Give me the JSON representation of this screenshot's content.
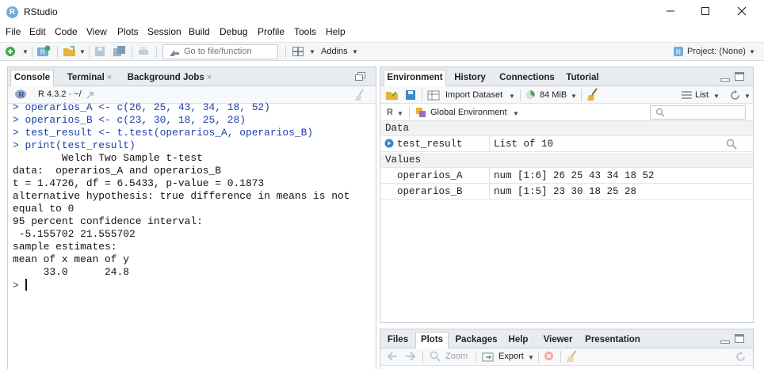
{
  "window": {
    "title": "RStudio"
  },
  "menu": [
    "File",
    "Edit",
    "Code",
    "View",
    "Plots",
    "Session",
    "Build",
    "Debug",
    "Profile",
    "Tools",
    "Help"
  ],
  "toolbar": {
    "goto_placeholder": "Go to file/function",
    "addins_label": "Addins",
    "project_label": "Project: (None)"
  },
  "console": {
    "tabs": [
      {
        "label": "Console",
        "closable": false
      },
      {
        "label": "Terminal",
        "closable": true
      },
      {
        "label": "Background Jobs",
        "closable": true
      }
    ],
    "close_glyph": "×",
    "r_version": "R 4.3.2 · ~/",
    "prompt": ">",
    "lines": [
      {
        "text": "> operarios_A <- c(26, 25, 43, 34, 18, 52)",
        "kind": "cmd"
      },
      {
        "text": "> operarios_B <- c(23, 30, 18, 25, 28)",
        "kind": "cmd"
      },
      {
        "text": "> test_result <- t.test(operarios_A, operarios_B)",
        "kind": "cmd"
      },
      {
        "text": "> print(test_result)",
        "kind": "cmd"
      },
      {
        "text": "",
        "kind": "out"
      },
      {
        "text": "\tWelch Two Sample t-test",
        "kind": "out"
      },
      {
        "text": "",
        "kind": "out"
      },
      {
        "text": "data:  operarios_A and operarios_B",
        "kind": "out"
      },
      {
        "text": "t = 1.4726, df = 6.5433, p-value = 0.1873",
        "kind": "out"
      },
      {
        "text": "alternative hypothesis: true difference in means is not",
        "kind": "out"
      },
      {
        "text": "equal to 0",
        "kind": "out"
      },
      {
        "text": "95 percent confidence interval:",
        "kind": "out"
      },
      {
        "text": " -5.155702 21.555702",
        "kind": "out"
      },
      {
        "text": "sample estimates:",
        "kind": "out"
      },
      {
        "text": "mean of x mean of y ",
        "kind": "out"
      },
      {
        "text": "     33.0      24.8 ",
        "kind": "out"
      },
      {
        "text": "",
        "kind": "out"
      }
    ]
  },
  "environment": {
    "tabs": [
      "Environment",
      "History",
      "Connections",
      "Tutorial"
    ],
    "import_label": "Import Dataset",
    "memory_label": "84 MiB",
    "list_label": "List",
    "language_label": "R",
    "scope_label": "Global Environment",
    "data_header": "Data",
    "data_rows": [
      {
        "name": "test_result",
        "value": "List of  10"
      }
    ],
    "values_header": "Values",
    "value_rows": [
      {
        "name": "operarios_A",
        "value": "num [1:6] 26 25 43 34 18 52"
      },
      {
        "name": "operarios_B",
        "value": "num [1:5] 23 30 18 25 28"
      }
    ]
  },
  "files": {
    "tabs": [
      "Files",
      "Plots",
      "Packages",
      "Help",
      "Viewer",
      "Presentation"
    ],
    "active_tab": "Plots",
    "zoom_label": "Zoom",
    "export_label": "Export"
  },
  "colors": {
    "accent": "#75aadb",
    "command": "#1b3fad",
    "pane_border": "#c9ced4"
  }
}
